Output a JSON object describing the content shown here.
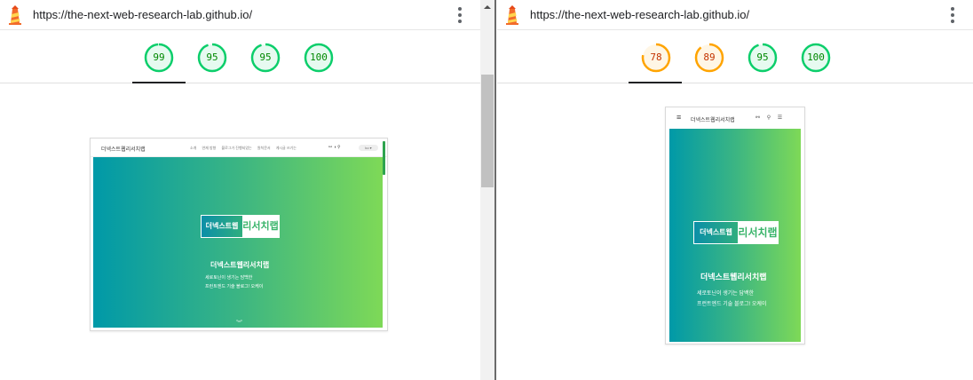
{
  "left": {
    "url": "https://the-next-web-research-lab.github.io/",
    "scores": [
      {
        "value": 99,
        "color": "#0cce6b",
        "text_color": "#008800"
      },
      {
        "value": 95,
        "color": "#0cce6b",
        "text_color": "#008800"
      },
      {
        "value": 95,
        "color": "#0cce6b",
        "text_color": "#008800"
      },
      {
        "value": 100,
        "color": "#0cce6b",
        "text_color": "#008800"
      }
    ],
    "screenshot": {
      "brand": "더넥스트웹리서치랩",
      "nav_links": [
        "소개",
        "연재 방향",
        "블로그가 진행되었는",
        "원칙문서",
        "게시글 쓰기는"
      ],
      "icons_text": "⚯ ◑ ⚲",
      "pill_text": "ko ▾",
      "logo_left": "더넥스트웹",
      "logo_right": "리서치랩",
      "hero_title": "더넥스트웹리서치랩",
      "hero_line1": "세로토닌이 생기는 담백한",
      "hero_line2": "프런트엔드 기술 블로그! 오케이",
      "chevron": "︾"
    }
  },
  "right": {
    "url": "https://the-next-web-research-lab.github.io/",
    "scores": [
      {
        "value": 78,
        "color": "#ffa400",
        "text_color": "#c33300"
      },
      {
        "value": 89,
        "color": "#ffa400",
        "text_color": "#c33300"
      },
      {
        "value": 95,
        "color": "#0cce6b",
        "text_color": "#008800"
      },
      {
        "value": 100,
        "color": "#0cce6b",
        "text_color": "#008800"
      }
    ],
    "screenshot": {
      "menu_icon": "≡",
      "brand": "더넥스트웹리서치랩",
      "icons_text": "⚯ ⚲ ☰",
      "logo_left": "더넥스트웹",
      "logo_right": "리서치랩",
      "hero_title": "더넥스트웹리서치랩",
      "hero_line1": "세로토닌이 생기는 담백한",
      "hero_line2": "프런트엔드 기술 블로그! 오케이"
    }
  }
}
